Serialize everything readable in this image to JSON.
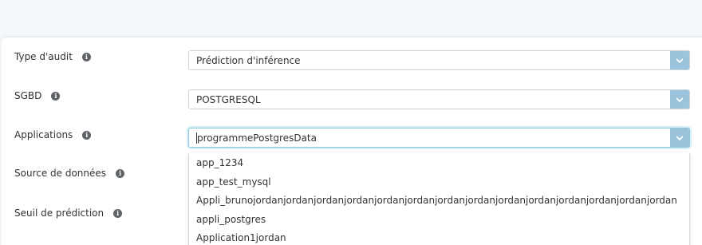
{
  "form": {
    "rows": [
      {
        "label": "Type d'audit",
        "value": "Prédiction d'inférence"
      },
      {
        "label": "SGBD",
        "value": "POSTGRESQL"
      },
      {
        "label": "Applications",
        "value": "programmePostgresData"
      },
      {
        "label": "Source de données"
      },
      {
        "label": "Seuil de prédiction"
      }
    ],
    "info_glyph": "i"
  },
  "dropdown": {
    "options": [
      "app_1234",
      "app_test_mysql",
      "Appli_brunojordanjordanjordanjordanjordanjordanjordanjordanjordanjordanjordanjordanjordanjordan",
      "appli_postgres",
      "Application1jordan"
    ]
  },
  "icons": {
    "info": "info-icon",
    "chevron": "chevron-down-icon"
  },
  "colors": {
    "accent": "#9cc3dc",
    "focus": "#8ec7da",
    "background": "#f3f6fa"
  }
}
